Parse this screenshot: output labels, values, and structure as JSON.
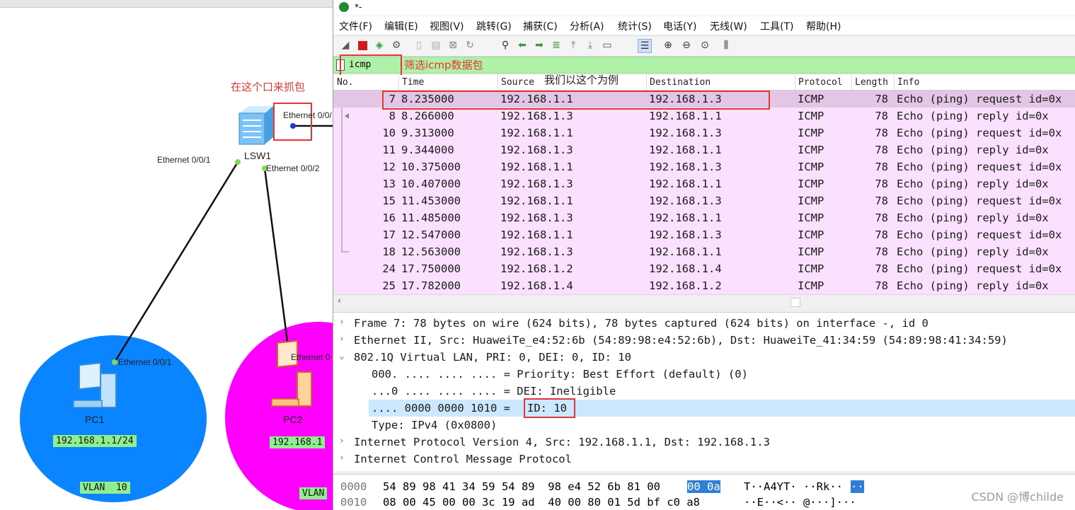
{
  "topology": {
    "annotation_capture": "在这个口来抓包",
    "switch_label": "LSW1",
    "switch_port_right": "Ethernet 0/0/",
    "switch_port_left": "Ethernet 0/0/1",
    "switch_port_mid": "Ethernet 0/0/2",
    "pc1": {
      "label": "PC1",
      "port": "Ethernet 0/0/1",
      "ip": "192.168.1.1/24",
      "vlan": "VLAN  10",
      "zone_color": "#0a84ff"
    },
    "pc2": {
      "label": "PC2",
      "port": "Ethernet 0",
      "ip": "192.168.1",
      "vlan": "VLAN",
      "zone_color": "#ff00ff"
    }
  },
  "wireshark": {
    "title": "*-",
    "menu": [
      "文件(F)",
      "编辑(E)",
      "视图(V)",
      "跳转(G)",
      "捕获(C)",
      "分析(A)",
      "统计(S)",
      "电话(Y)",
      "无线(W)",
      "工具(T)",
      "帮助(H)"
    ],
    "toolbar_icons": [
      "shark-fin-start-icon",
      "stop-icon",
      "restart-icon",
      "options-icon",
      "open-icon",
      "save-icon",
      "close-file-icon",
      "reload-icon",
      "find-icon",
      "back-icon",
      "forward-icon",
      "goto-icon",
      "first-icon",
      "last-icon",
      "autoscroll-icon",
      "colorize-icon",
      "zoom-in-icon",
      "zoom-out-icon",
      "zoom-normal-icon",
      "resize-columns-icon"
    ],
    "filter": {
      "value": "icmp",
      "annotation": "筛选icmp数据包"
    },
    "example_annotation": "我们以这个为例",
    "columns": [
      "No.",
      "Time",
      "Source",
      "Destination",
      "Protocol",
      "Length",
      "Info"
    ],
    "packets": [
      {
        "no": "7",
        "time": "8.235000",
        "src": "192.168.1.1",
        "dst": "192.168.1.3",
        "proto": "ICMP",
        "len": "78",
        "info": "Echo (ping) request  id=0x"
      },
      {
        "no": "8",
        "time": "8.266000",
        "src": "192.168.1.3",
        "dst": "192.168.1.1",
        "proto": "ICMP",
        "len": "78",
        "info": "Echo (ping) reply    id=0x"
      },
      {
        "no": "10",
        "time": "9.313000",
        "src": "192.168.1.1",
        "dst": "192.168.1.3",
        "proto": "ICMP",
        "len": "78",
        "info": "Echo (ping) request  id=0x"
      },
      {
        "no": "11",
        "time": "9.344000",
        "src": "192.168.1.3",
        "dst": "192.168.1.1",
        "proto": "ICMP",
        "len": "78",
        "info": "Echo (ping) reply    id=0x"
      },
      {
        "no": "12",
        "time": "10.375000",
        "src": "192.168.1.1",
        "dst": "192.168.1.3",
        "proto": "ICMP",
        "len": "78",
        "info": "Echo (ping) request  id=0x"
      },
      {
        "no": "13",
        "time": "10.407000",
        "src": "192.168.1.3",
        "dst": "192.168.1.1",
        "proto": "ICMP",
        "len": "78",
        "info": "Echo (ping) reply    id=0x"
      },
      {
        "no": "15",
        "time": "11.453000",
        "src": "192.168.1.1",
        "dst": "192.168.1.3",
        "proto": "ICMP",
        "len": "78",
        "info": "Echo (ping) request  id=0x"
      },
      {
        "no": "16",
        "time": "11.485000",
        "src": "192.168.1.3",
        "dst": "192.168.1.1",
        "proto": "ICMP",
        "len": "78",
        "info": "Echo (ping) reply    id=0x"
      },
      {
        "no": "17",
        "time": "12.547000",
        "src": "192.168.1.1",
        "dst": "192.168.1.3",
        "proto": "ICMP",
        "len": "78",
        "info": "Echo (ping) request  id=0x"
      },
      {
        "no": "18",
        "time": "12.563000",
        "src": "192.168.1.3",
        "dst": "192.168.1.1",
        "proto": "ICMP",
        "len": "78",
        "info": "Echo (ping) reply    id=0x"
      },
      {
        "no": "24",
        "time": "17.750000",
        "src": "192.168.1.2",
        "dst": "192.168.1.4",
        "proto": "ICMP",
        "len": "78",
        "info": "Echo (ping) request  id=0x"
      },
      {
        "no": "25",
        "time": "17.782000",
        "src": "192.168.1.4",
        "dst": "192.168.1.2",
        "proto": "ICMP",
        "len": "78",
        "info": "Echo (ping) reply    id=0x"
      }
    ],
    "details": [
      {
        "text": "Frame 7: 78 bytes on wire (624 bits), 78 bytes captured (624 bits) on interface -, id 0",
        "arrow": "›"
      },
      {
        "text": "Ethernet II, Src: HuaweiTe_e4:52:6b (54:89:98:e4:52:6b), Dst: HuaweiTe_41:34:59 (54:89:98:41:34:59)",
        "arrow": "›"
      },
      {
        "text": "802.1Q Virtual LAN, PRI: 0, DEI: 0, ID: 10",
        "arrow": "⌄"
      },
      {
        "text": "000. .... .... .... = Priority: Best Effort (default) (0)",
        "arrow": ""
      },
      {
        "text": "...0 .... .... .... = DEI: Ineligible",
        "arrow": ""
      },
      {
        "text": ".... 0000 0000 1010 = ",
        "highlight": "ID: 10",
        "arrow": ""
      },
      {
        "text": "Type: IPv4 (0x0800)",
        "arrow": ""
      },
      {
        "text": "Internet Protocol Version 4, Src: 192.168.1.1, Dst: 192.168.1.3",
        "arrow": "›"
      },
      {
        "text": "Internet Control Message Protocol",
        "arrow": "›"
      }
    ],
    "bytes": [
      {
        "offset": "0000",
        "hex_a": "54 89 98 41 34 59 54 89  98 e4 52 6b 81 00",
        "hex_sel": "00 0a",
        "ascii_a": "T··A4YT· ··Rk··",
        "ascii_sel": "··"
      },
      {
        "offset": "0010",
        "hex_a": "08 00 45 00 00 3c 19 ad  40 00 80 01 5d bf c0 a8",
        "hex_sel": "",
        "ascii_a": "··E··<·· @···]···",
        "ascii_sel": ""
      }
    ],
    "watermark": "CSDN @博childe",
    "colors": {
      "row_bg": "#fce0ff",
      "row_selected": "#e3c6e5",
      "filter_bg": "#aff1a8",
      "annotation": "#e53535",
      "byte_selected": "#2f7fd4"
    }
  }
}
